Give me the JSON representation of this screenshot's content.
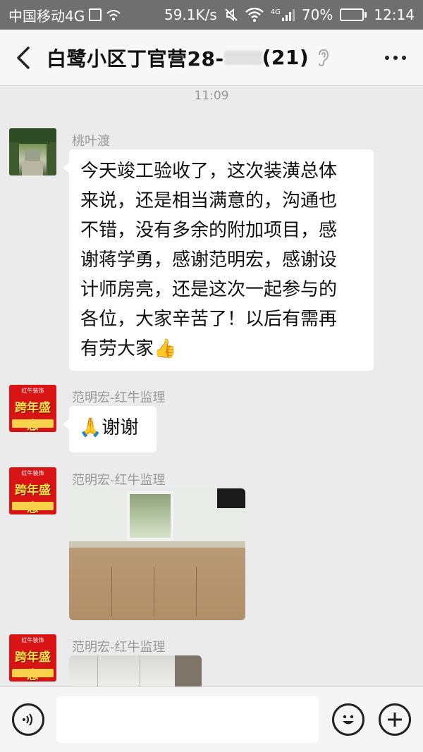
{
  "status_bar": {
    "carrier": "中国移动4G",
    "speed": "59.1K/s",
    "network_label": "4G",
    "battery": "70%",
    "battery_level": 0.7,
    "time": "12:14"
  },
  "header": {
    "title": "白鹭小区丁官营28-",
    "count": "(21)"
  },
  "chat": {
    "timestamp": "11:09",
    "messages": [
      {
        "sender": "桃叶渡",
        "avatar": "landscape-avatar",
        "lines": [
          "今天竣工验收了，这次装潢总体",
          "来说，还是相当满意的，沟通也",
          "不错，没有多余的附加项目，感",
          "谢蒋学勇，感谢范明宏，感谢设",
          "计师房亮，还是这次一起参与的",
          "各位，大家辛苦了！以后有需再",
          "有劳大家👍"
        ]
      },
      {
        "sender": "范明宏-红牛监理",
        "avatar": "promo-avatar",
        "text": "🙏谢谢"
      },
      {
        "sender": "范明宏-红牛监理",
        "avatar": "promo-avatar",
        "image": "kitchen-photo"
      },
      {
        "sender": "范明宏-红牛监理",
        "avatar": "promo-avatar",
        "image": "wardrobe-photo"
      }
    ],
    "promo_avatar_top": "红牛装饰",
    "promo_avatar_main": "跨年盛惠"
  },
  "input_bar": {
    "placeholder": ""
  },
  "colors": {
    "background": "#ebebeb",
    "header": "#f7f7f7",
    "status_bar": "#6f6f6f",
    "bubble": "#ffffff",
    "promo_red": "#d81414"
  }
}
